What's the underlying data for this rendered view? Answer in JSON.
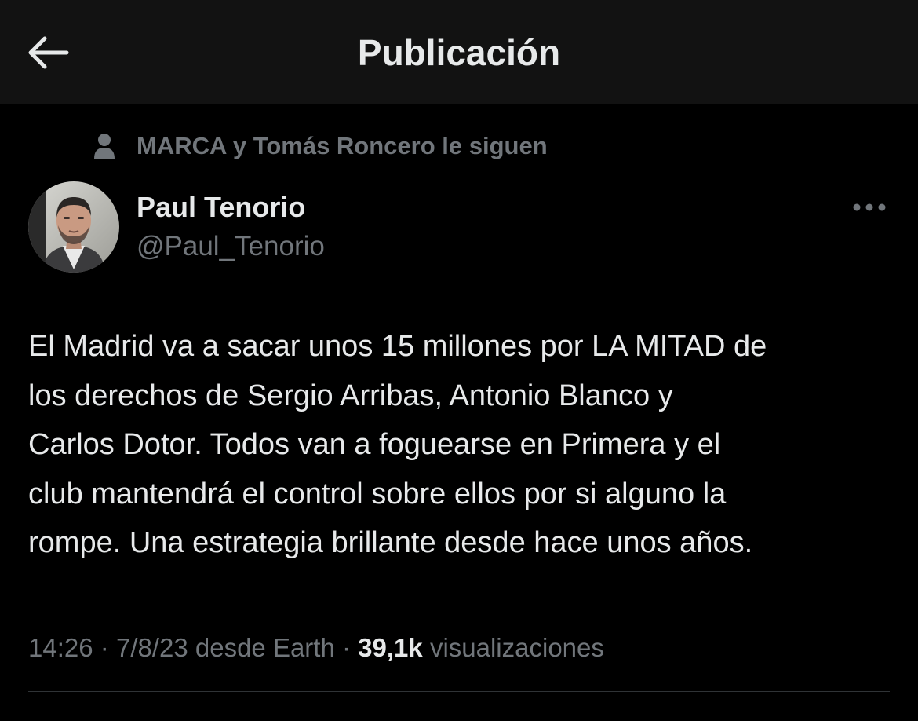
{
  "header": {
    "title": "Publicación",
    "back_icon": "arrow-left-icon"
  },
  "social_context": {
    "icon": "person-icon",
    "text": "MARCA y Tomás Roncero le siguen"
  },
  "author": {
    "name": "Paul Tenorio",
    "handle": "@Paul_Tenorio",
    "avatar": "profile-photo"
  },
  "more_icon": "more-horizontal-icon",
  "tweet": {
    "text": "El Madrid va a sacar unos 15 millones por LA MITAD de\nlos derechos de Sergio Arribas, Antonio Blanco y\nCarlos Dotor. Todos van a foguearse en Primera y el\nclub mantendrá el control sobre ellos por si alguno la\nrompe. Una estrategia brillante desde hace unos años."
  },
  "meta": {
    "time": "14:26",
    "date": "7/8/23",
    "source": "desde Earth",
    "separator": "·",
    "views_count": "39,1k",
    "views_label": "visualizaciones"
  },
  "colors": {
    "background": "#000000",
    "header_background": "#121212",
    "primary_text": "#e7e9ea",
    "secondary_text": "#71767b",
    "divider": "#2f3336"
  }
}
